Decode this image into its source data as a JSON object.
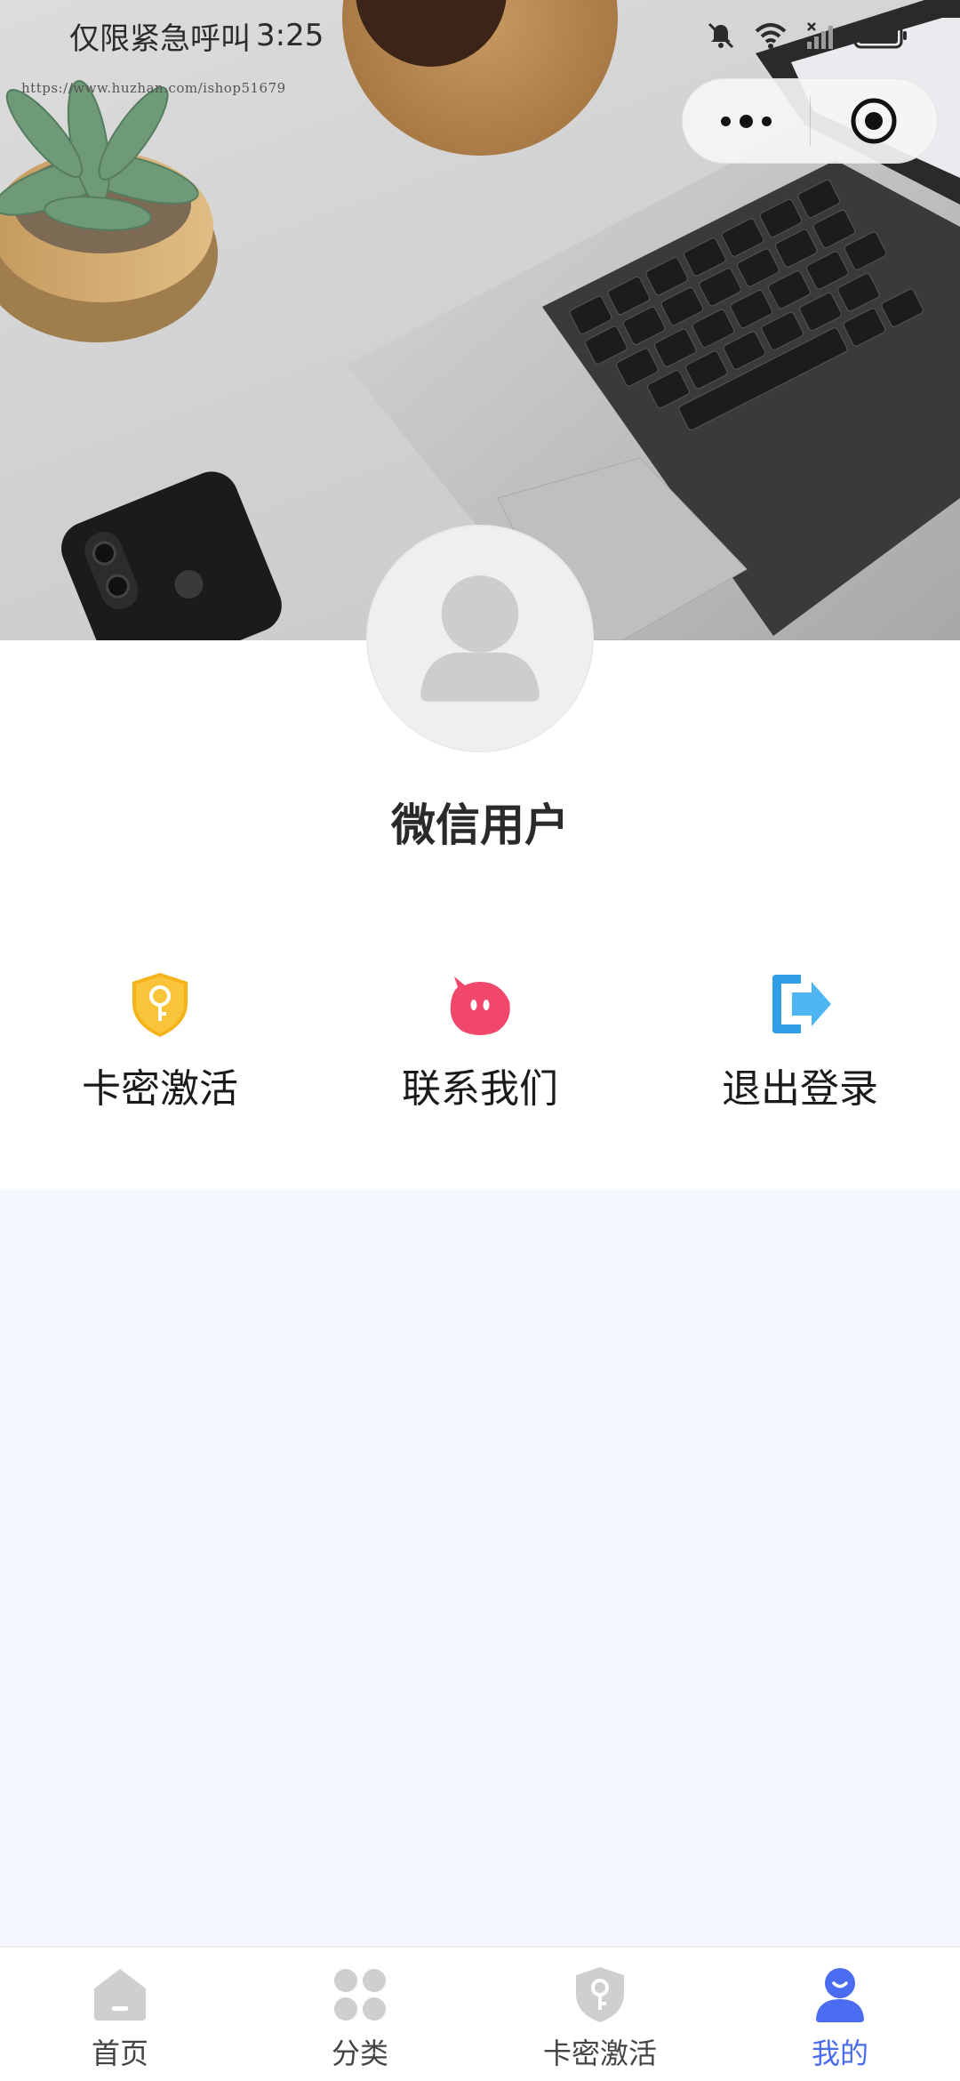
{
  "status_bar": {
    "carrier": "仅限紧急呼叫",
    "time": "3:25"
  },
  "watermark": "https://www.huzhan.com/ishop51679",
  "capsule": {
    "more_icon": "more-dots-icon",
    "close_icon": "target-circle-icon"
  },
  "profile": {
    "username": "微信用户",
    "avatar_icon": "user-silhouette-icon"
  },
  "actions": [
    {
      "label": "卡密激活",
      "icon": "shield-key-icon",
      "color": "#f5b31b"
    },
    {
      "label": "联系我们",
      "icon": "pink-creature-icon",
      "color": "#f0476a"
    },
    {
      "label": "退出登录",
      "icon": "logout-arrow-icon",
      "color": "#2f9ee6"
    }
  ],
  "tabbar": {
    "tabs": [
      {
        "label": "首页",
        "icon": "home-icon",
        "active": false
      },
      {
        "label": "分类",
        "icon": "category-icon",
        "active": false
      },
      {
        "label": "卡密激活",
        "icon": "shield-key-icon",
        "active": false
      },
      {
        "label": "我的",
        "icon": "user-icon",
        "active": true
      }
    ],
    "active_color": "#4a6cf0",
    "inactive_color": "#cfcfcf"
  }
}
